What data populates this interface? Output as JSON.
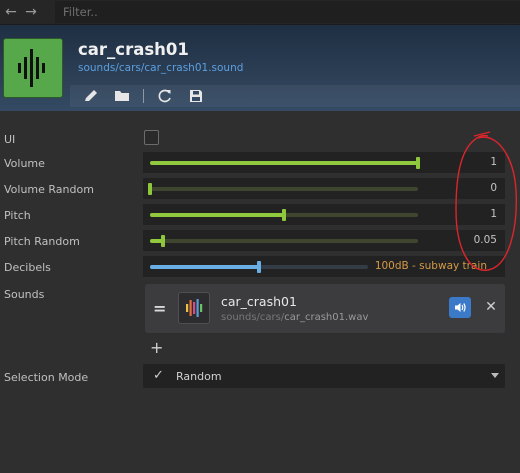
{
  "nav": {
    "back_icon": "arrow-left-icon",
    "forward_icon": "arrow-right-icon"
  },
  "filter": {
    "placeholder": "Filter..",
    "value": ""
  },
  "asset": {
    "name": "car_crash01",
    "path": "sounds/cars/car_crash01.sound",
    "icon": "sound-waveform-icon",
    "icon_color": "#57a84a",
    "tools": [
      "pencil-icon",
      "folder-icon",
      "refresh-icon",
      "save-icon"
    ]
  },
  "properties": {
    "ui": {
      "label": "UI",
      "checked": false
    },
    "volume": {
      "label": "Volume",
      "value": "1",
      "fraction": 1.0
    },
    "volume_random": {
      "label": "Volume Random",
      "value": "0",
      "fraction": 0.0
    },
    "pitch": {
      "label": "Pitch",
      "value": "1",
      "fraction": 0.5
    },
    "pitch_random": {
      "label": "Pitch Random",
      "value": "0.05",
      "fraction": 0.05
    },
    "decibels": {
      "label": "Decibels",
      "value": "100dB - subway train",
      "fraction": 0.5
    },
    "sounds": {
      "label": "Sounds",
      "items": [
        {
          "name": "car_crash01",
          "path_prefix": "sounds/cars/",
          "file": "car_crash01.wav"
        }
      ],
      "add_label": "+"
    },
    "selection_mode": {
      "label": "Selection Mode",
      "value": "Random"
    }
  },
  "colors": {
    "accent_green": "#90c93e",
    "accent_blue": "#6aaee6",
    "decibel_text": "#d59a47",
    "play_button": "#3b79c9",
    "annotation": "#d9262c"
  }
}
